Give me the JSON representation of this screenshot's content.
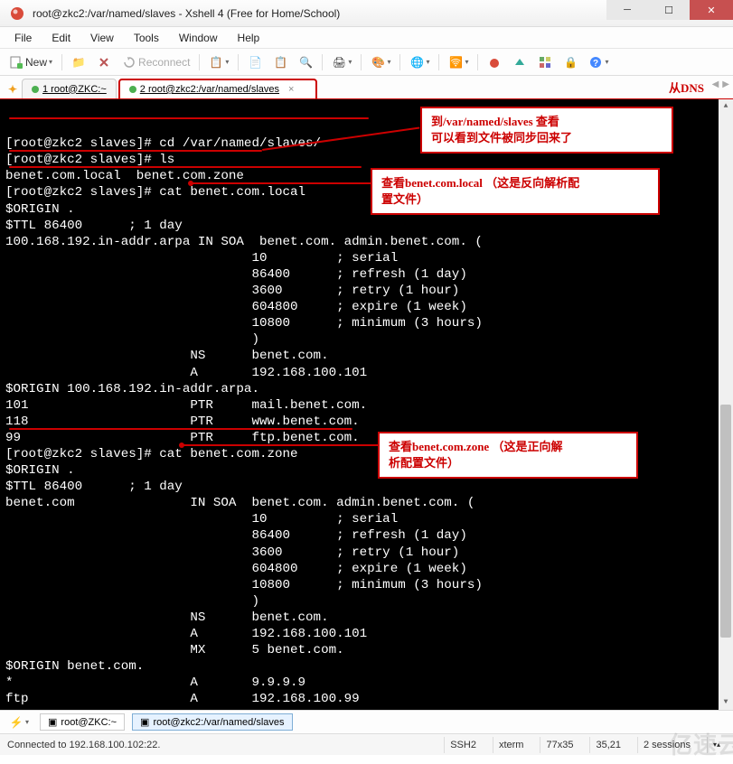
{
  "window": {
    "title": "root@zkc2:/var/named/slaves - Xshell 4 (Free for Home/School)"
  },
  "menu": {
    "file": "File",
    "edit": "Edit",
    "view": "View",
    "tools": "Tools",
    "window": "Window",
    "help": "Help"
  },
  "toolbar": {
    "new": "New",
    "reconnect": "Reconnect"
  },
  "tabs": {
    "tab1": "1 root@ZKC:~",
    "tab2": "2 root@zkc2:/var/named/slaves",
    "annot_label": "从DNS"
  },
  "terminal": {
    "lines": [
      "[root@zkc2 slaves]# cd /var/named/slaves/",
      "[root@zkc2 slaves]# ls",
      "benet.com.local  benet.com.zone",
      "[root@zkc2 slaves]# cat benet.com.local",
      "$ORIGIN .",
      "$TTL 86400      ; 1 day",
      "100.168.192.in-addr.arpa IN SOA  benet.com. admin.benet.com. (",
      "                                10         ; serial",
      "                                86400      ; refresh (1 day)",
      "                                3600       ; retry (1 hour)",
      "                                604800     ; expire (1 week)",
      "                                10800      ; minimum (3 hours)",
      "                                )",
      "                        NS      benet.com.",
      "                        A       192.168.100.101",
      "$ORIGIN 100.168.192.in-addr.arpa.",
      "101                     PTR     mail.benet.com.",
      "118                     PTR     www.benet.com.",
      "99                      PTR     ftp.benet.com.",
      "[root@zkc2 slaves]# cat benet.com.zone",
      "$ORIGIN .",
      "$TTL 86400      ; 1 day",
      "benet.com               IN SOA  benet.com. admin.benet.com. (",
      "                                10         ; serial",
      "                                86400      ; refresh (1 day)",
      "                                3600       ; retry (1 hour)",
      "                                604800     ; expire (1 week)",
      "                                10800      ; minimum (3 hours)",
      "                                )",
      "                        NS      benet.com.",
      "                        A       192.168.100.101",
      "                        MX      5 benet.com.",
      "$ORIGIN benet.com.",
      "*                       A       9.9.9.9",
      "ftp                     A       192.168.100.99"
    ]
  },
  "callouts": {
    "c1_l1": "到/var/named/slaves 查看",
    "c1_l2": "可以看到文件被同步回来了",
    "c2_l1": "查看benet.com.local （这是反向解析配",
    "c2_l2": "置文件）",
    "c3_l1": "查看benet.com.zone （这是正向解",
    "c3_l2": "析配置文件）"
  },
  "bottom_tabs": {
    "t1": "root@ZKC:~",
    "t2": "root@zkc2:/var/named/slaves"
  },
  "status": {
    "conn": "Connected to 192.168.100.102:22.",
    "ssh": "SSH2",
    "term": "xterm",
    "size": "77x35",
    "cursor": "35,21",
    "sessions": "2 sessions"
  },
  "watermark": "亿速云"
}
